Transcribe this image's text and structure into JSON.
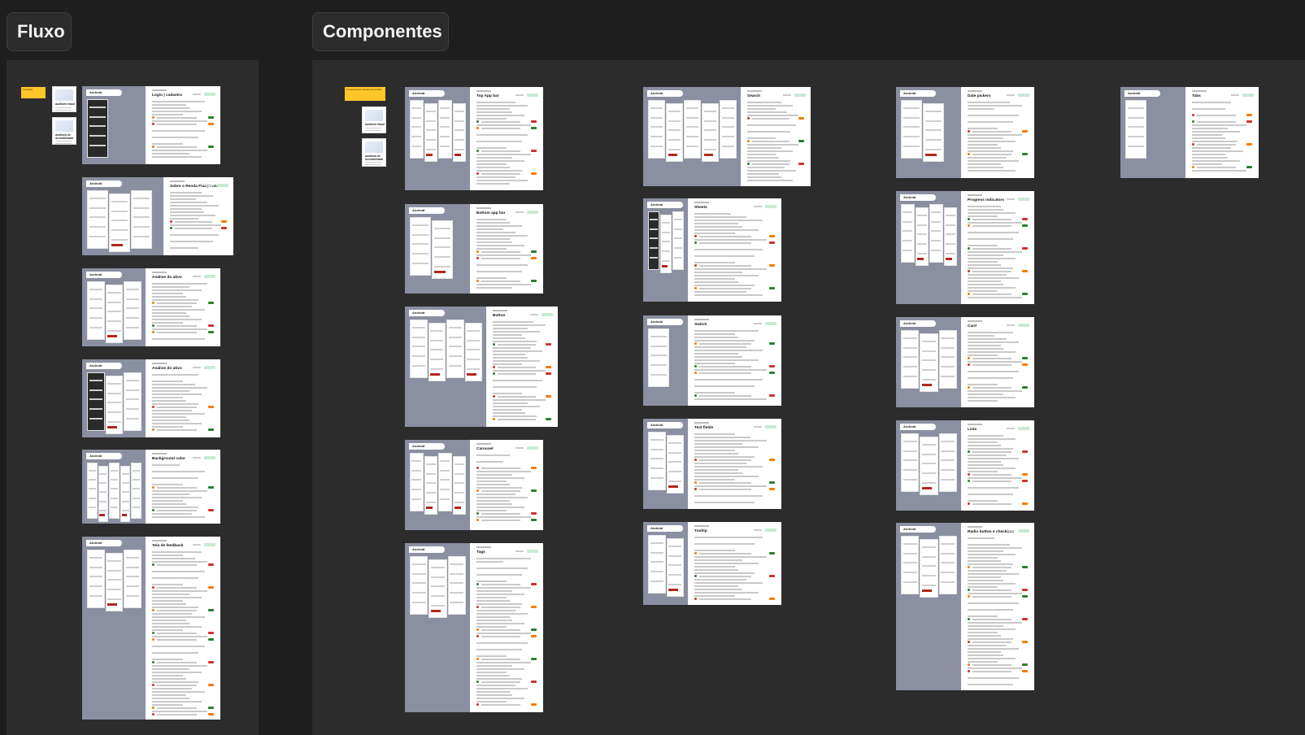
{
  "sections": {
    "fluxo": {
      "label": "Fluxo"
    },
    "componentes": {
      "label": "Componentes"
    }
  },
  "platform_label": "Android",
  "colors": {
    "canvas": "#1e1e1e",
    "section": "#2c2c2c",
    "frame_gray": "#8a90a1",
    "sticky": "#ffc629",
    "status_green": "#2e7d32",
    "status_red": "#d32f2f",
    "status_orange": "#f57c00",
    "accent_red": "#b3261e"
  },
  "fluxo": {
    "sticky_note": "Checklist",
    "cards": [
      {
        "title": "Auditoria visual"
      },
      {
        "title": "Auditoria de Acessibilidade"
      }
    ],
    "frames": [
      {
        "title": "Login | cadastro"
      },
      {
        "title": "Sobre o Renda Fixa | Fundos"
      },
      {
        "title": "Análise do ativo"
      },
      {
        "title": "Análise do ativo"
      },
      {
        "title": "Background color"
      },
      {
        "title": "Tela de feedback"
      }
    ]
  },
  "componentes": {
    "sticky_note": "Componentes visuais do produto",
    "cards": [
      {
        "title": "Auditoria visual"
      },
      {
        "title": "Auditoria de Acessibilidade"
      }
    ],
    "frames": [
      {
        "title": "Top App bar"
      },
      {
        "title": "Bottom app bar"
      },
      {
        "title": "Button"
      },
      {
        "title": "Carousel"
      },
      {
        "title": "Tags"
      },
      {
        "title": "Search"
      },
      {
        "title": "Sheets"
      },
      {
        "title": "Switch"
      },
      {
        "title": "Text fields"
      },
      {
        "title": "Tooltip"
      },
      {
        "title": "Date pickers"
      },
      {
        "title": "Progress indicators"
      },
      {
        "title": "Card"
      },
      {
        "title": "Lists"
      },
      {
        "title": "Radio button e checkbox"
      },
      {
        "title": "Tabs"
      }
    ]
  }
}
